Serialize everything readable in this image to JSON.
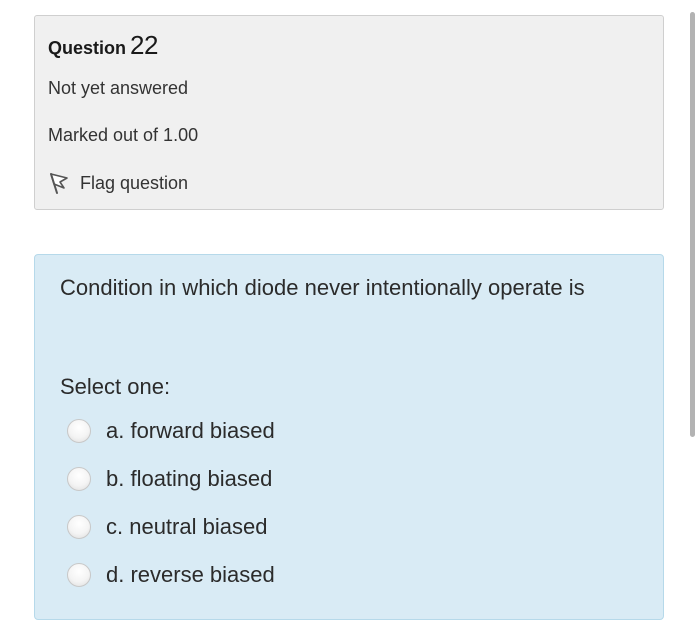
{
  "info": {
    "question_word": "Question",
    "question_number": "22",
    "state": "Not yet answered",
    "grade": "Marked out of 1.00",
    "flag_label": "Flag question",
    "flag_icon": "flag-icon"
  },
  "content": {
    "question_text": "Condition in which diode never intentionally operate is",
    "prompt": "Select one:",
    "answers": [
      {
        "label": "a. forward biased",
        "selected": false
      },
      {
        "label": "b. floating biased",
        "selected": false
      },
      {
        "label": "c. neutral biased",
        "selected": false
      },
      {
        "label": "d. reverse biased",
        "selected": false
      }
    ]
  },
  "colors": {
    "info_background": "#f0f0f0",
    "content_background": "#d9ebf5",
    "content_border": "#b6d9ea"
  }
}
